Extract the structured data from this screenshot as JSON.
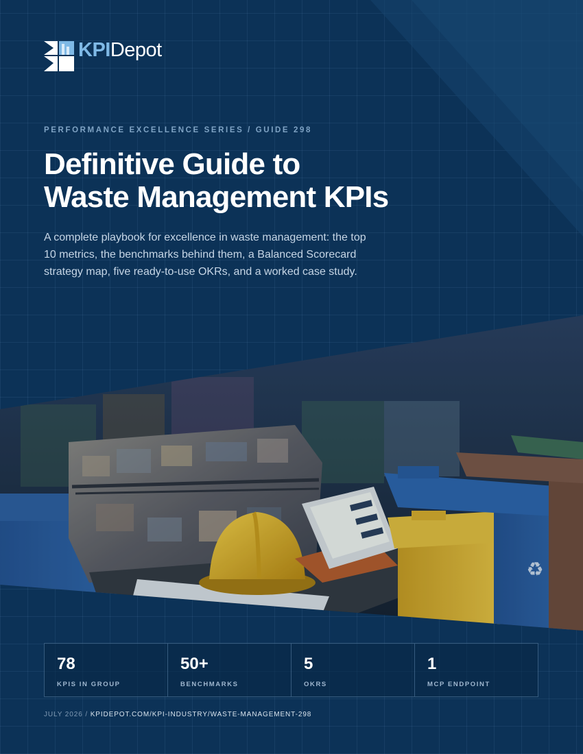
{
  "brand": {
    "name_part1": "KPI",
    "name_part2": "Depot",
    "logo_icon": "kpidepot-logo-mark"
  },
  "header": {
    "series": "PERFORMANCE EXCELLENCE SERIES / GUIDE 298",
    "title_line1": "Definitive Guide to",
    "title_line2": "Waste Management KPIs",
    "lede": "A complete playbook for excellence in waste management: the top 10 metrics, the benchmarks behind them, a Balanced Scorecard strategy map, five ready-to-use OKRs, and a worked case study."
  },
  "image": {
    "subject": "waste-management-photo"
  },
  "stats": [
    {
      "value": "78",
      "label": "KPIS IN GROUP"
    },
    {
      "value": "50+",
      "label": "BENCHMARKS"
    },
    {
      "value": "5",
      "label": "OKRS"
    },
    {
      "value": "1",
      "label": "MCP ENDPOINT"
    }
  ],
  "footer": {
    "date": "JULY 2026",
    "separator": " / ",
    "url": "KPIDEPOT.COM/KPI-INDUSTRY/WASTE-MANAGEMENT-298"
  },
  "colors": {
    "background": "#0c3257",
    "accent": "#7fb9e6",
    "bin_blue": "#2a5fa5",
    "bin_yellow": "#d7b12a",
    "hard_hat": "#e2b21f"
  }
}
